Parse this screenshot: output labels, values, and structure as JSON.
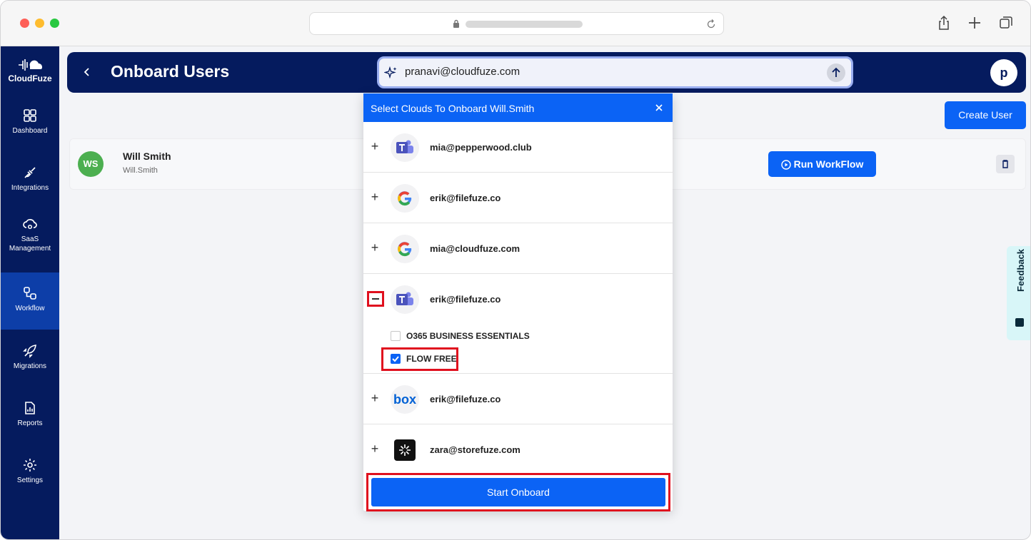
{
  "browser": {
    "url_hidden": true
  },
  "sidebar": {
    "brand": "CloudFuze",
    "items": [
      {
        "label": "Dashboard",
        "icon": "dashboard-icon"
      },
      {
        "label": "Integrations",
        "icon": "plug-icon"
      },
      {
        "label": "SaaS Management",
        "icon": "cloud-gear-icon"
      },
      {
        "label": "Workflow",
        "icon": "workflow-icon",
        "active": true
      },
      {
        "label": "Migrations",
        "icon": "rocket-icon"
      },
      {
        "label": "Reports",
        "icon": "report-icon"
      },
      {
        "label": "Settings",
        "icon": "gear-icon"
      }
    ]
  },
  "header": {
    "title": "Onboard Users",
    "avatar_letter": "p"
  },
  "search": {
    "value": "pranavi@cloudfuze.com"
  },
  "toolbar": {
    "create_user_label": "Create User"
  },
  "user": {
    "initials": "WS",
    "name": "Will Smith",
    "handle": "Will.Smith",
    "run_workflow_label": "Run WorkFlow"
  },
  "feedback_label": "Feedback",
  "modal": {
    "title": "Select Clouds To Onboard Will.Smith",
    "clouds": [
      {
        "provider": "teams",
        "email": "mia@pepperwood.club",
        "expanded": false
      },
      {
        "provider": "google",
        "email": "erik@filefuze.co",
        "expanded": false
      },
      {
        "provider": "google",
        "email": "mia@cloudfuze.com",
        "expanded": false
      },
      {
        "provider": "teams",
        "email": "erik@filefuze.co",
        "expanded": true
      },
      {
        "provider": "box",
        "email": "erik@filefuze.co",
        "expanded": false
      },
      {
        "provider": "storefuze",
        "email": "zara@storefuze.com",
        "expanded": false
      }
    ],
    "plans": [
      {
        "label": "O365 BUSINESS ESSENTIALS",
        "checked": false
      },
      {
        "label": "FLOW FREE",
        "checked": true
      }
    ],
    "box_logo_text": "box",
    "start_label": "Start Onboard"
  },
  "colors": {
    "navy": "#051b5e",
    "primary": "#0b63f5",
    "highlight": "#e0101e"
  }
}
